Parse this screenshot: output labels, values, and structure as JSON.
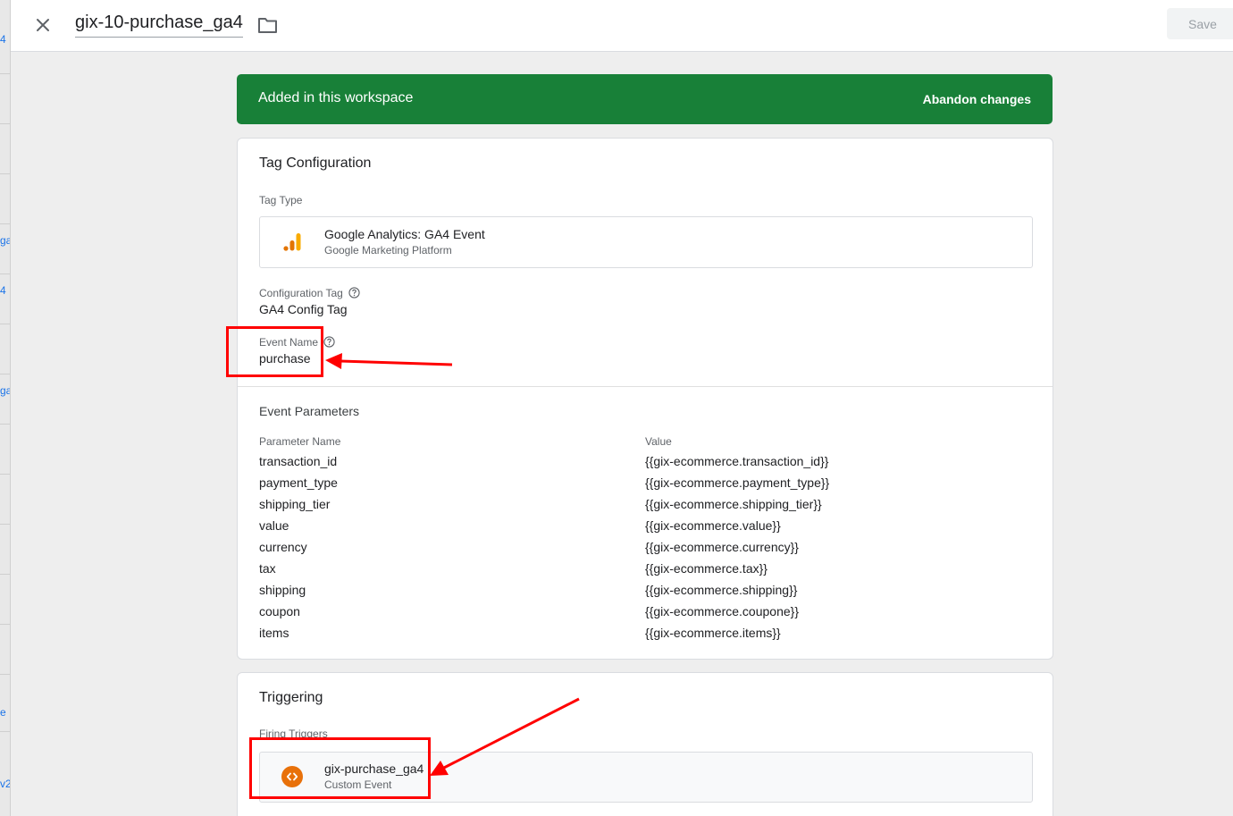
{
  "background": {
    "fragments": [
      "4",
      "ga",
      "4",
      "ga",
      "e",
      "v2"
    ]
  },
  "topbar": {
    "title": "gix-10-purchase_ga4",
    "save_label": "Save"
  },
  "banner": {
    "title": "Added in this workspace",
    "action_label": "Abandon changes",
    "color": "#188038"
  },
  "tag_config": {
    "section_title": "Tag Configuration",
    "tag_type_label": "Tag Type",
    "tag_type_name": "Google Analytics: GA4 Event",
    "tag_type_platform": "Google Marketing Platform",
    "config_tag_label": "Configuration Tag",
    "config_tag_value": "GA4 Config Tag",
    "event_name_label": "Event Name",
    "event_name_value": "purchase",
    "event_params_title": "Event Parameters",
    "param_name_header": "Parameter Name",
    "param_value_header": "Value",
    "params": [
      {
        "name": "transaction_id",
        "value": "{{gix-ecommerce.transaction_id}}"
      },
      {
        "name": "payment_type",
        "value": "{{gix-ecommerce.payment_type}}"
      },
      {
        "name": "shipping_tier",
        "value": "{{gix-ecommerce.shipping_tier}}"
      },
      {
        "name": "value",
        "value": "{{gix-ecommerce.value}}"
      },
      {
        "name": "currency",
        "value": "{{gix-ecommerce.currency}}"
      },
      {
        "name": "tax",
        "value": "{{gix-ecommerce.tax}}"
      },
      {
        "name": "shipping",
        "value": "{{gix-ecommerce.shipping}}"
      },
      {
        "name": "coupon",
        "value": "{{gix-ecommerce.coupone}}"
      },
      {
        "name": "items",
        "value": "{{gix-ecommerce.items}}"
      }
    ]
  },
  "triggering": {
    "section_title": "Triggering",
    "firing_label": "Firing Triggers",
    "trigger_name": "gix-purchase_ga4",
    "trigger_type": "Custom Event",
    "trigger_color": "#e8710a"
  },
  "icons": {
    "close": "close-icon",
    "folder": "folder-icon",
    "ga4": "analytics-bars-icon",
    "help": "help-circle-icon",
    "trigger": "code-brackets-icon"
  },
  "annotation_color": "#ff0000"
}
